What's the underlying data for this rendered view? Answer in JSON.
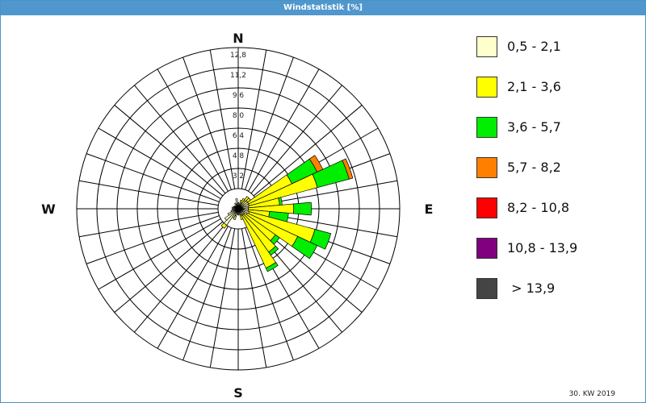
{
  "window": {
    "title": "Windstatistik [%]"
  },
  "footer": {
    "week": "30. KW 2019"
  },
  "chart_data": {
    "type": "wind-rose",
    "directions_count": 36,
    "compass": {
      "n": "N",
      "e": "E",
      "s": "S",
      "w": "W"
    },
    "rmax": 12.8,
    "ring_values": [
      1.6,
      3.2,
      4.8,
      6.4,
      8.0,
      9.6,
      11.2,
      12.8
    ],
    "ring_labels": [
      "",
      "3,2",
      "4,8",
      "6,4",
      "8,0",
      "9,6",
      "11,2",
      "12,8"
    ],
    "legend": [
      {
        "label": "0,5 - 2,1",
        "color": "#ffffcc"
      },
      {
        "label": "2,1 - 3,6",
        "color": "#ffff00"
      },
      {
        "label": "3,6 - 5,7",
        "color": "#00ee00"
      },
      {
        "label": "5,7 - 8,2",
        "color": "#ff8000"
      },
      {
        "label": "8,2 - 10,8",
        "color": "#ff0000"
      },
      {
        "label": "10,8 - 13,9",
        "color": "#800080"
      },
      {
        "label": " > 13,9",
        "color": "#444444"
      }
    ],
    "sectors": [
      {
        "dir": 0,
        "values": [
          0.3,
          0.2
        ]
      },
      {
        "dir": 10,
        "values": [
          0.3
        ]
      },
      {
        "dir": 20,
        "values": [
          0.4,
          0.3
        ]
      },
      {
        "dir": 30,
        "values": [
          0.5,
          0.4
        ]
      },
      {
        "dir": 40,
        "values": [
          0.8,
          0.4
        ]
      },
      {
        "dir": 50,
        "values": [
          0.9,
          0.3
        ]
      },
      {
        "dir": 60,
        "values": [
          0.9,
          3.8,
          2.2,
          0.5
        ]
      },
      {
        "dir": 70,
        "values": [
          0.9,
          5.6,
          2.6,
          0.3
        ]
      },
      {
        "dir": 80,
        "values": [
          0.8,
          2.5,
          0.2
        ]
      },
      {
        "dir": 90,
        "values": [
          0.8,
          3.6,
          1.4
        ]
      },
      {
        "dir": 100,
        "values": [
          0.8,
          1.7,
          1.5
        ]
      },
      {
        "dir": 110,
        "values": [
          0.9,
          5.4,
          1.3
        ]
      },
      {
        "dir": 120,
        "values": [
          0.8,
          4.4,
          1.7
        ]
      },
      {
        "dir": 130,
        "values": [
          0.6,
          3.0,
          0.4
        ]
      },
      {
        "dir": 140,
        "values": [
          0.6,
          3.6,
          0.3
        ]
      },
      {
        "dir": 150,
        "values": [
          0.6,
          4.6,
          0.3
        ]
      },
      {
        "dir": 160,
        "values": [
          0.5,
          0.4
        ]
      },
      {
        "dir": 170,
        "values": [
          0.5
        ]
      },
      {
        "dir": 180,
        "values": [
          0.5
        ]
      },
      {
        "dir": 190,
        "values": [
          0.4
        ]
      },
      {
        "dir": 200,
        "values": [
          0.6,
          0.3
        ]
      },
      {
        "dir": 210,
        "values": [
          0.8
        ]
      },
      {
        "dir": 220,
        "values": [
          1.6,
          0.3
        ]
      },
      {
        "dir": 230,
        "values": [
          1.3
        ]
      },
      {
        "dir": 240,
        "values": [
          0.9
        ]
      },
      {
        "dir": 250,
        "values": [
          0.6
        ]
      },
      {
        "dir": 260,
        "values": [
          0.5
        ]
      },
      {
        "dir": 270,
        "values": [
          0.4
        ]
      },
      {
        "dir": 280,
        "values": [
          0.5
        ]
      },
      {
        "dir": 290,
        "values": [
          0.4
        ]
      },
      {
        "dir": 300,
        "values": [
          0.4
        ]
      },
      {
        "dir": 310,
        "values": [
          0.3
        ]
      },
      {
        "dir": 320,
        "values": [
          0.3
        ]
      },
      {
        "dir": 330,
        "values": [
          0.5
        ]
      },
      {
        "dir": 340,
        "values": [
          0.4
        ]
      },
      {
        "dir": 350,
        "values": [
          0.8
        ]
      }
    ]
  }
}
